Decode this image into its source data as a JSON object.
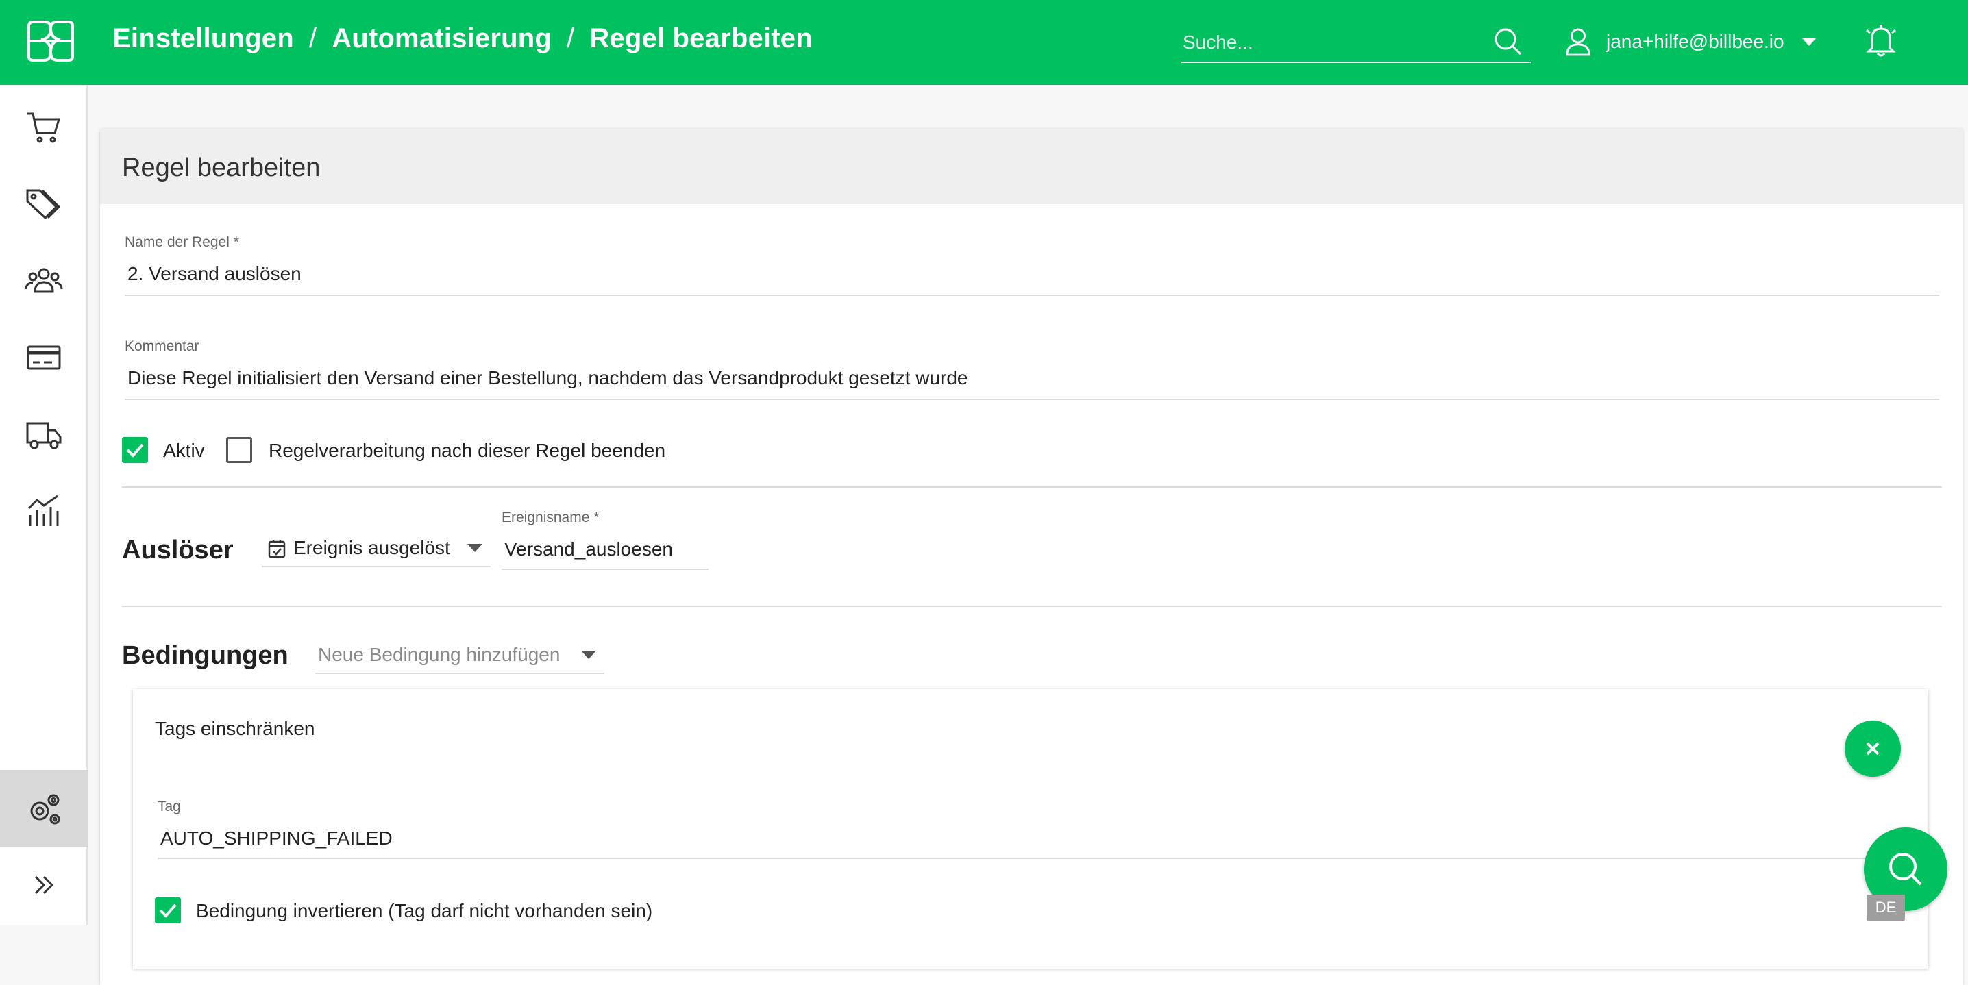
{
  "header": {
    "breadcrumb": [
      "Einstellungen",
      "Automatisierung",
      "Regel bearbeiten"
    ],
    "separator": "/",
    "search_placeholder": "Suche...",
    "user_email": "jana+hilfe@billbee.io"
  },
  "sidebar": {
    "items": [
      {
        "icon": "cart-icon"
      },
      {
        "icon": "tags-icon"
      },
      {
        "icon": "customers-icon"
      },
      {
        "icon": "payment-card-icon"
      },
      {
        "icon": "truck-icon"
      },
      {
        "icon": "statistics-icon"
      },
      {
        "icon": "settings-gears-icon",
        "active": true
      },
      {
        "icon": "expand-chevrons-icon"
      }
    ]
  },
  "card": {
    "title": "Regel bearbeiten",
    "name_label": "Name der Regel *",
    "name_value": "2. Versand auslösen",
    "comment_label": "Kommentar",
    "comment_value": "Diese Regel initialisiert den Versand einer Bestellung, nachdem das Versandprodukt gesetzt wurde",
    "active_label": "Aktiv",
    "active_checked": true,
    "stop_label": "Regelverarbeitung nach dieser Regel beenden",
    "stop_checked": false
  },
  "trigger": {
    "title": "Auslöser",
    "type_value": "Ereignis ausgelöst",
    "event_label": "Ereignisname *",
    "event_value": "Versand_ausloesen"
  },
  "conditions": {
    "title": "Bedingungen",
    "add_placeholder": "Neue Bedingung hinzufügen",
    "items": [
      {
        "title": "Tags einschränken",
        "tag_label": "Tag",
        "tag_value": "AUTO_SHIPPING_FAILED",
        "invert_label": "Bedingung invertieren (Tag darf nicht vorhanden sein)",
        "invert_checked": true
      }
    ]
  },
  "language_badge": "DE",
  "colors": {
    "brand": "#00c060",
    "active_nav": "#d9d9d9"
  }
}
